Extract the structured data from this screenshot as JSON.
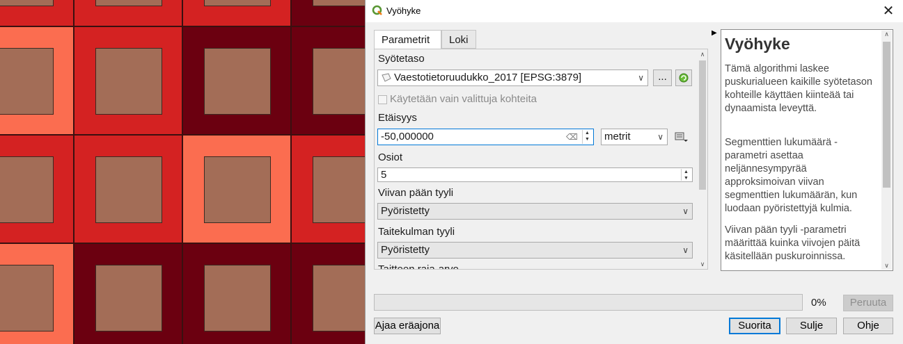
{
  "window": {
    "title": "Vyöhyke",
    "close": "✕"
  },
  "tabs": [
    {
      "label": "Parametrit",
      "active": true
    },
    {
      "label": "Loki",
      "active": false
    }
  ],
  "params": {
    "input_layer_label": "Syötetaso",
    "input_layer_value": "Vaestotietoruudukko_2017 [EPSG:3879]",
    "browse_label": "...",
    "selected_only_label": "Käytetään vain valittuja kohteita",
    "distance_label": "Etäisyys",
    "distance_value": "-50,000000",
    "distance_unit": "metrit",
    "segments_label": "Osiot",
    "segments_value": "5",
    "end_cap_label": "Viivan pään tyyli",
    "end_cap_value": "Pyöristetty",
    "join_style_label": "Taitekulman tyyli",
    "join_style_value": "Pyöristetty",
    "miter_label_partial": "Taitteen raja-arvo"
  },
  "help": {
    "title": "Vyöhyke",
    "para1": "Tämä algorithmi laskee puskurialueen kaikille syötetason kohteille käyttäen kiinteää tai dynaamista leveyttä.",
    "para2": "Segmenttien lukumäärä -parametri asettaa neljännesympyrää approksimoivan viivan segmenttien lukumäärän, kun luodaan pyöristettyjä kulmia.",
    "para3": "Viivan pään tyyli -parametri määrittää kuinka viivojen päitä käsitellään puskuroinnissa."
  },
  "footer": {
    "progress_percent": 0,
    "progress_text": "0%",
    "cancel_label": "Peruuta",
    "batch_label": "Ajaa eräajona",
    "run_label": "Suorita",
    "close_label": "Sulje",
    "help_label": "Ohje"
  },
  "map_colors": {
    "dark": "#6b0010",
    "red": "#d42222",
    "coral": "#fb6d50",
    "inner": "#a36d57"
  }
}
